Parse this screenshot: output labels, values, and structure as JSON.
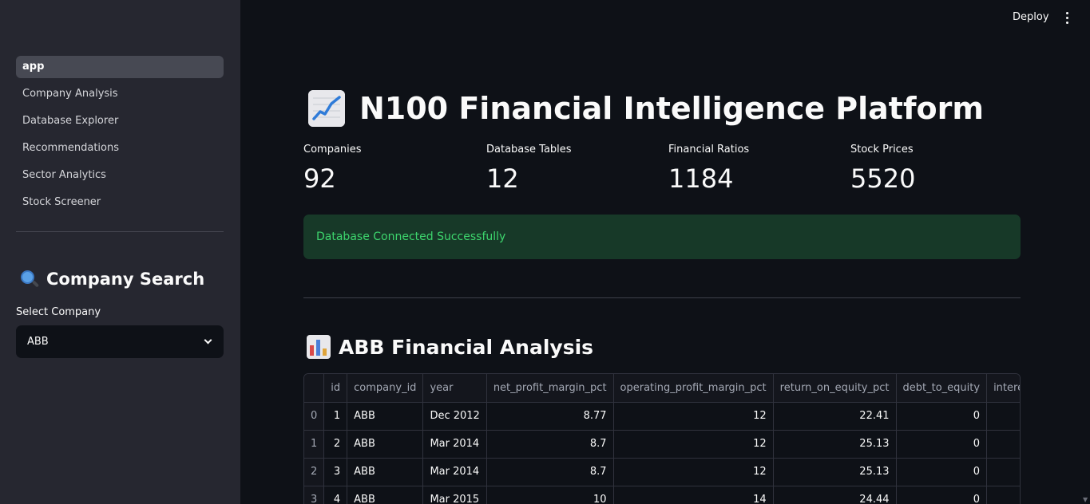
{
  "sidebar": {
    "nav": [
      {
        "label": "app",
        "active": true
      },
      {
        "label": "Company Analysis",
        "active": false
      },
      {
        "label": "Database Explorer",
        "active": false
      },
      {
        "label": "Recommendations",
        "active": false
      },
      {
        "label": "Sector Analytics",
        "active": false
      },
      {
        "label": "Stock Screener",
        "active": false
      }
    ],
    "search_title": "Company Search",
    "search_icon": "magnifying-glass-icon",
    "select_label": "Select Company",
    "select_value": "ABB"
  },
  "header": {
    "deploy_label": "Deploy",
    "menu_icon": "kebab-menu-icon"
  },
  "main": {
    "title": "N100 Financial Intelligence Platform",
    "title_icon": "chart-increasing-icon",
    "metrics": [
      {
        "label": "Companies",
        "value": "92"
      },
      {
        "label": "Database Tables",
        "value": "12"
      },
      {
        "label": "Financial Ratios",
        "value": "1184"
      },
      {
        "label": "Stock Prices",
        "value": "5520"
      }
    ],
    "alert": "Database Connected Successfully",
    "section_title": "ABB Financial Analysis",
    "section_icon": "bar-chart-icon",
    "table": {
      "columns": [
        "",
        "id",
        "company_id",
        "year",
        "net_profit_margin_pct",
        "operating_profit_margin_pct",
        "return_on_equity_pct",
        "debt_to_equity",
        "interes"
      ],
      "rows": [
        [
          "0",
          "1",
          "ABB",
          "Dec 2012",
          "8.77",
          "12",
          "22.41",
          "0",
          ""
        ],
        [
          "1",
          "2",
          "ABB",
          "Mar 2014",
          "8.7",
          "12",
          "25.13",
          "0",
          ""
        ],
        [
          "2",
          "3",
          "ABB",
          "Mar 2014",
          "8.7",
          "12",
          "25.13",
          "0",
          ""
        ],
        [
          "3",
          "4",
          "ABB",
          "Mar 2015",
          "10",
          "14",
          "24.44",
          "0",
          ""
        ]
      ]
    }
  },
  "colors": {
    "background": "#0e1117",
    "sidebar": "#262730",
    "success_bg": "#173928",
    "success_text": "#3dd56d"
  }
}
